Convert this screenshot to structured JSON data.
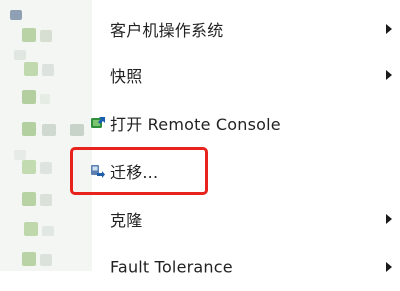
{
  "context_menu": {
    "items": [
      {
        "label": "客户机操作系统",
        "has_submenu": true,
        "icon": ""
      },
      {
        "label": "快照",
        "has_submenu": true,
        "icon": ""
      },
      {
        "label": "打开 Remote Console",
        "has_submenu": false,
        "icon": "remote-console-icon"
      },
      {
        "label": "迁移...",
        "has_submenu": false,
        "icon": "migrate-icon"
      },
      {
        "label": "克隆",
        "has_submenu": true,
        "icon": ""
      },
      {
        "label": "Fault Tolerance",
        "has_submenu": true,
        "icon": ""
      }
    ],
    "highlighted_item": "迁移...",
    "highlight_color": "#e8221c"
  }
}
